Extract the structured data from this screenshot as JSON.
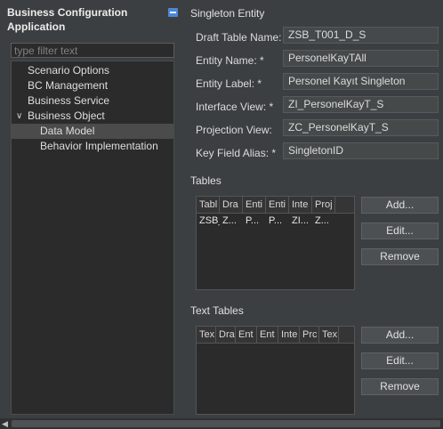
{
  "left_panel": {
    "title": "Business Configuration Application",
    "filter_placeholder": "type filter text",
    "tree": [
      {
        "label": "Scenario Options"
      },
      {
        "label": "BC Management"
      },
      {
        "label": "Business Service"
      },
      {
        "label": "Business Object",
        "expanded": true
      },
      {
        "label": "Data Model",
        "selected": true
      },
      {
        "label": "Behavior Implementation"
      }
    ]
  },
  "entity": {
    "section_title": "Singleton Entity",
    "fields": [
      {
        "label": "Draft Table Name: *",
        "value": "ZSB_T001_D_S"
      },
      {
        "label": "Entity Name: *",
        "value": "PersonelKayTAll"
      },
      {
        "label": "Entity Label: *",
        "value": "Personel Kayıt Singleton"
      },
      {
        "label": "Interface View: *",
        "value": "ZI_PersonelKayT_S"
      },
      {
        "label": "Projection View: ",
        "value": "ZC_PersonelKayT_S"
      },
      {
        "label": "Key Field Alias: *",
        "value": "SingletonID"
      }
    ]
  },
  "tables": {
    "section_title": "Tables",
    "columns": [
      "Tabl",
      "Dra",
      "Enti",
      "Enti",
      "Inte",
      "Proj"
    ],
    "rows": [
      [
        "ZSB_",
        "Z...",
        "P...",
        "P...",
        "ZI...",
        "Z..."
      ]
    ],
    "buttons": {
      "add": "Add...",
      "edit": "Edit...",
      "remove": "Remove"
    }
  },
  "text_tables": {
    "section_title": "Text Tables",
    "columns": [
      "Tex",
      "Dra",
      "Ent",
      "Ent",
      "Inte",
      "Prc",
      "Tex"
    ],
    "buttons": {
      "add": "Add...",
      "edit": "Edit...",
      "remove": "Remove"
    }
  },
  "colors": {
    "background": "#3c3f41",
    "input_background": "#45494a",
    "tree_background": "#2b2b2b",
    "selected_row": "#4b4b4b",
    "accent_icon": "#4a88d8"
  },
  "icons": {
    "collapse": "collapse-icon",
    "expand_arrow": "chevron-down-icon",
    "scroll_left": "scroll-left-arrow-icon"
  }
}
